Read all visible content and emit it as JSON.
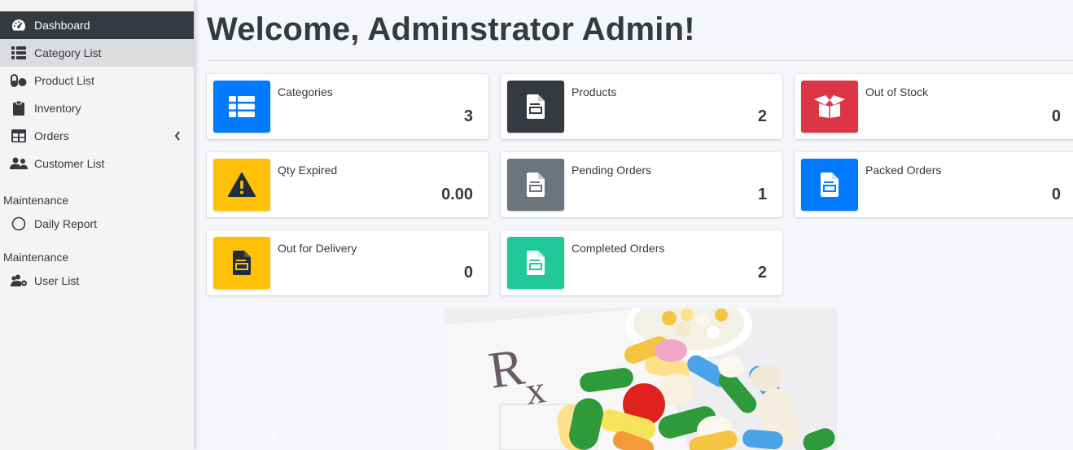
{
  "sidebar": {
    "items": [
      {
        "label": "Dashboard",
        "icon": "tachometer-icon"
      },
      {
        "label": "Category List",
        "icon": "list-icon"
      },
      {
        "label": "Product List",
        "icon": "pills-icon"
      },
      {
        "label": "Inventory",
        "icon": "clipboard-icon"
      },
      {
        "label": "Orders",
        "icon": "table-icon"
      },
      {
        "label": "Customer List",
        "icon": "users-icon"
      }
    ],
    "section1": "Maintenance",
    "daily_report": "Daily Report",
    "section2": "Maintenance",
    "user_list": "User List"
  },
  "main": {
    "title": "Welcome, Adminstrator Admin!"
  },
  "cards": [
    {
      "label": "Categories",
      "value": "3",
      "color": "#007bff",
      "icon": "th-list-icon"
    },
    {
      "label": "Products",
      "value": "2",
      "color": "#343a40",
      "icon": "file-prescription-icon"
    },
    {
      "label": "Out of Stock",
      "value": "0",
      "color": "#dc3545",
      "icon": "box-open-icon"
    },
    {
      "label": "Qty Expired",
      "value": "0.00",
      "color": "#ffc107",
      "icon": "warning-icon"
    },
    {
      "label": "Pending Orders",
      "value": "1",
      "color": "#6c757d",
      "icon": "file-invoice-icon"
    },
    {
      "label": "Packed Orders",
      "value": "0",
      "color": "#007bff",
      "icon": "file-invoice-icon"
    },
    {
      "label": "Out for Delivery",
      "value": "0",
      "color": "#ffc107",
      "icon": "file-invoice-icon"
    },
    {
      "label": "Completed Orders",
      "value": "2",
      "color": "#20c997",
      "icon": "file-invoice-icon"
    }
  ],
  "carousel": {
    "prev": "‹",
    "next": "›"
  }
}
